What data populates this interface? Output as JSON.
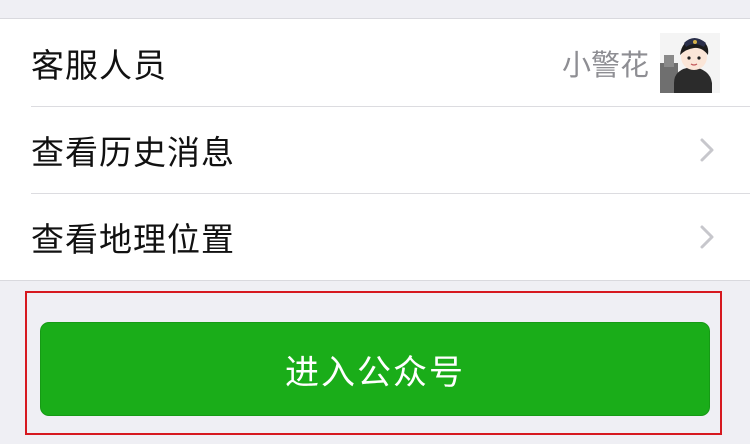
{
  "rows": [
    {
      "label": "客服人员",
      "value": "小警花",
      "icon": "avatar"
    },
    {
      "label": "查看历史消息",
      "icon": "chevron-right-icon"
    },
    {
      "label": "查看地理位置",
      "icon": "chevron-right-icon"
    }
  ],
  "enter_button": {
    "label": "进入公众号"
  },
  "colors": {
    "background": "#efeff4",
    "list_background": "#ffffff",
    "button_green": "#1aad19",
    "highlight_red": "#d6181f",
    "secondary_text": "#8e8e93"
  }
}
